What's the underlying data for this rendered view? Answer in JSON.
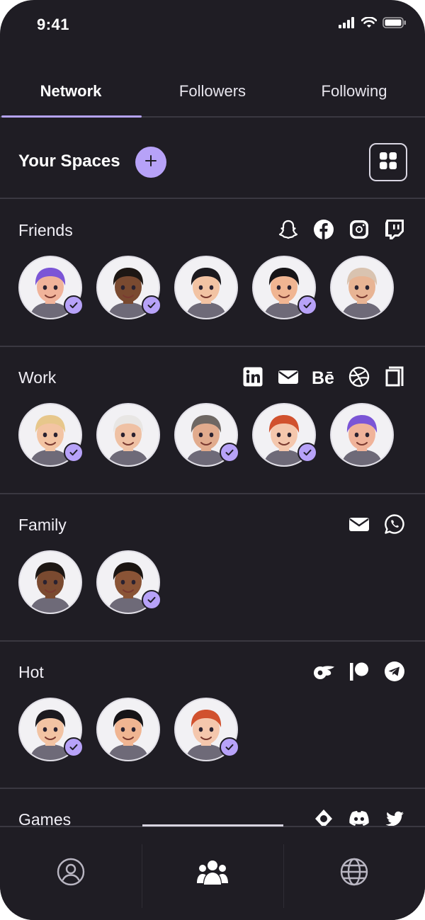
{
  "status_bar": {
    "time": "9:41"
  },
  "tabs": [
    {
      "label": "Network",
      "active": true
    },
    {
      "label": "Followers",
      "active": false
    },
    {
      "label": "Following",
      "active": false
    }
  ],
  "spaces": {
    "title": "Your Spaces",
    "add_icon": "plus-icon",
    "grid_icon": "grid-icon"
  },
  "sections": [
    {
      "title": "Friends",
      "icons": [
        "snapchat-icon",
        "facebook-icon",
        "instagram-icon",
        "twitch-icon"
      ],
      "avatars": [
        {
          "hair": "#7b55d6",
          "skin": "#f0b39a",
          "verified": true
        },
        {
          "hair": "#1d1714",
          "skin": "#7a4a30",
          "verified": true
        },
        {
          "hair": "#1c1a1f",
          "skin": "#f2c3a3",
          "verified": false
        },
        {
          "hair": "#161417",
          "skin": "#f0b592",
          "verified": true
        },
        {
          "hair": "#d9c3b0",
          "skin": "#e8b494",
          "verified": false
        }
      ]
    },
    {
      "title": "Work",
      "icons": [
        "linkedin-icon",
        "mail-icon",
        "behance-icon",
        "dribbble-icon",
        "gumroad-icon"
      ],
      "avatars": [
        {
          "hair": "#e7c78b",
          "skin": "#f3c4a3",
          "verified": true
        },
        {
          "hair": "#e8e6e4",
          "skin": "#efc1a4",
          "verified": false
        },
        {
          "hair": "#6e6763",
          "skin": "#e1ab8d",
          "verified": true
        },
        {
          "hair": "#d1512e",
          "skin": "#f4c7ad",
          "verified": true
        },
        {
          "hair": "#7b55d6",
          "skin": "#f0b39a",
          "verified": false
        }
      ]
    },
    {
      "title": "Family",
      "icons": [
        "mail-icon",
        "whatsapp-icon"
      ],
      "avatars": [
        {
          "hair": "#1d1714",
          "skin": "#7a4a30",
          "verified": false
        },
        {
          "hair": "#1b1512",
          "skin": "#8a5436",
          "verified": true
        }
      ]
    },
    {
      "title": "Hot",
      "icons": [
        "onlyfans-icon",
        "patreon-icon",
        "telegram-icon"
      ],
      "avatars": [
        {
          "hair": "#1c1a1f",
          "skin": "#f2c3a3",
          "verified": true
        },
        {
          "hair": "#161417",
          "skin": "#f0b592",
          "verified": false
        },
        {
          "hair": "#d1512e",
          "skin": "#f4c7ad",
          "verified": true
        }
      ]
    },
    {
      "title": "Games",
      "icons": [
        "steam-icon",
        "discord-icon",
        "twitter-icon"
      ],
      "avatars": []
    }
  ],
  "bottom_nav": [
    {
      "icon": "profile-icon",
      "active": false
    },
    {
      "icon": "people-icon",
      "active": true
    },
    {
      "icon": "globe-icon",
      "active": false
    }
  ],
  "colors": {
    "background": "#1f1d24",
    "accent": "#b7a2f8",
    "divider": "#3a3841"
  }
}
